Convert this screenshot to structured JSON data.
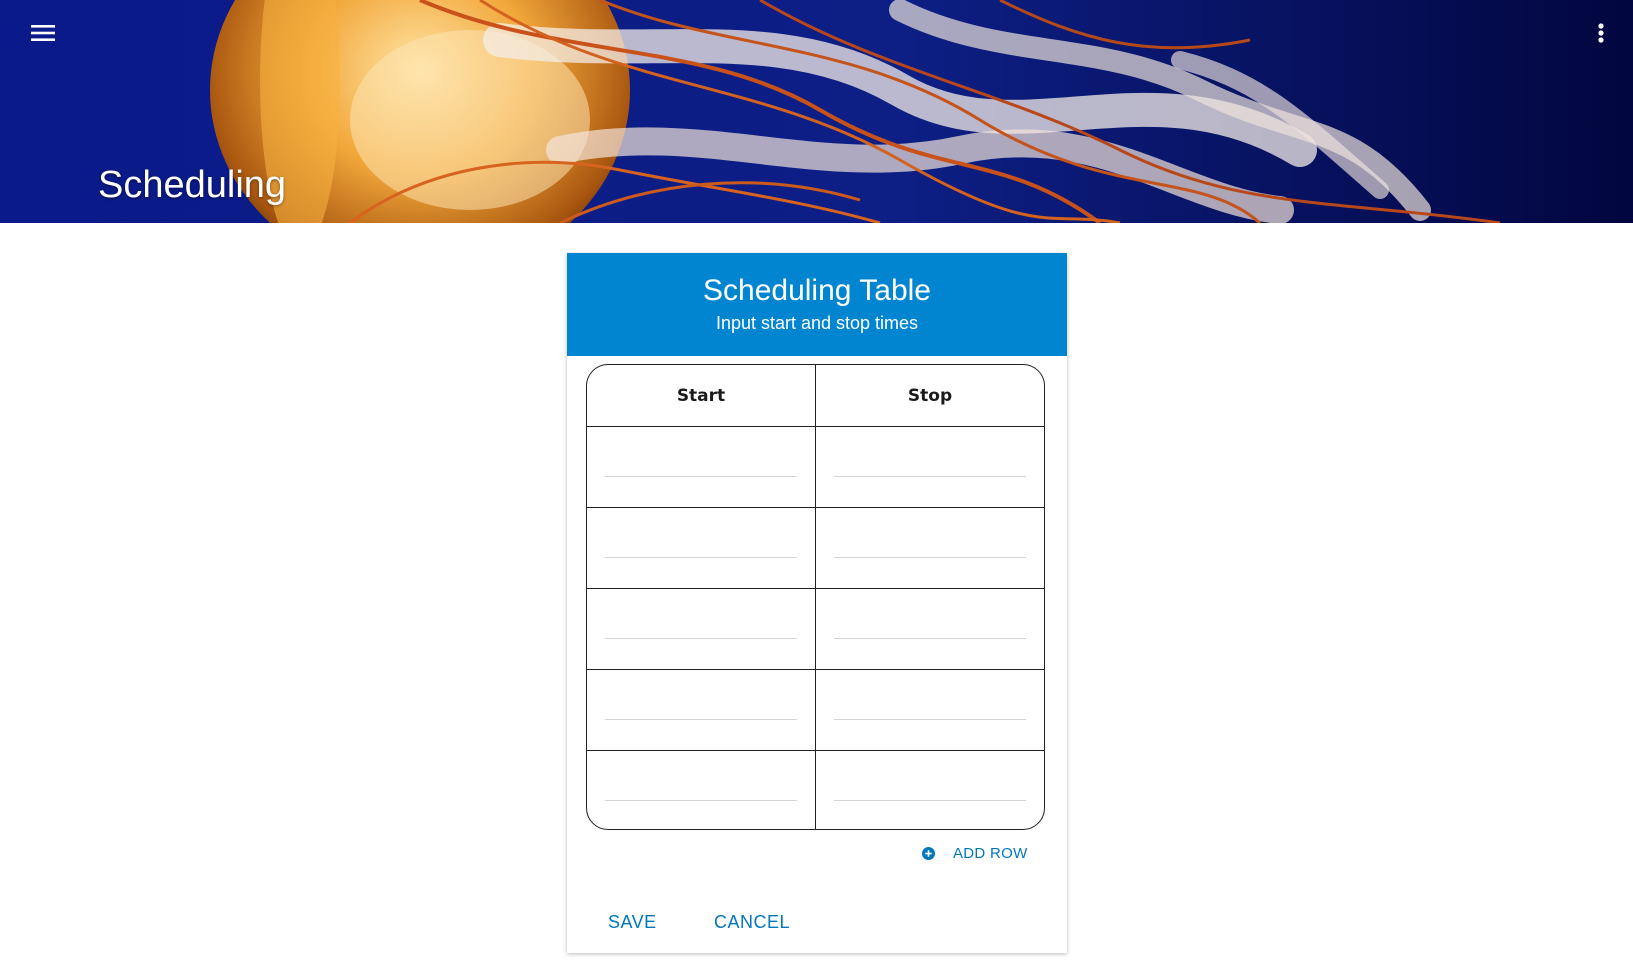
{
  "header": {
    "title": "Scheduling",
    "menu_icon": "hamburger-menu-icon",
    "more_icon": "more-vert-icon",
    "background_color": "#04106e"
  },
  "card": {
    "title": "Scheduling Table",
    "subtitle": "Input start and stop times",
    "header_color": "#0285d1"
  },
  "table": {
    "columns": [
      "Start",
      "Stop"
    ],
    "rows": [
      {
        "start": "",
        "stop": ""
      },
      {
        "start": "",
        "stop": ""
      },
      {
        "start": "",
        "stop": ""
      },
      {
        "start": "",
        "stop": ""
      },
      {
        "start": "",
        "stop": ""
      }
    ]
  },
  "add_row": {
    "label": "ADD ROW",
    "icon": "add-circle-icon"
  },
  "actions": {
    "save_label": "SAVE",
    "cancel_label": "CANCEL",
    "accent_color": "#0277bd"
  }
}
